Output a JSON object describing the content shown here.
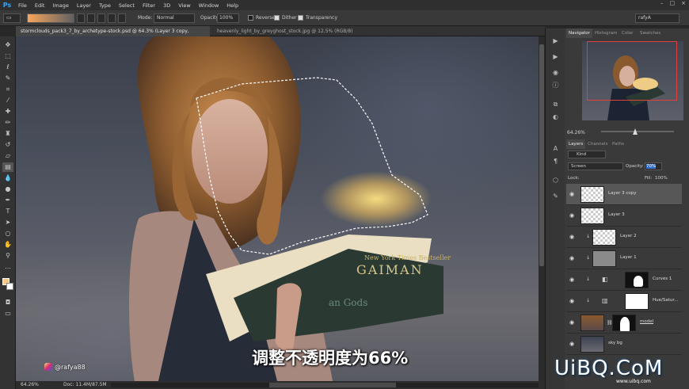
{
  "menubar": {
    "logo": "Ps",
    "items": [
      "File",
      "Edit",
      "Image",
      "Layer",
      "Type",
      "Select",
      "Filter",
      "3D",
      "View",
      "Window",
      "Help"
    ],
    "window_controls": [
      "–",
      "□",
      "×"
    ]
  },
  "options": {
    "mode_label": "Mode:",
    "mode_value": "Normal",
    "opacity_label": "Opacity:",
    "opacity_value": "100%",
    "reverse": "Reverse",
    "dither": "Dither",
    "transparency": "Transparency",
    "workspace": "rafyA",
    "gradient_colors": [
      "#f7a55a",
      "#ffffff"
    ]
  },
  "tabs": [
    {
      "label": "stormclouds_pack3_7_by_archetype-stock.psd @ 64.3% (Layer 3 copy, RGB/8) *",
      "active": true
    },
    {
      "label": "heavenly_light_by_greyghost_stock.jpg @ 12.5% (RGB/8)",
      "active": false
    }
  ],
  "status": {
    "zoom": "64.26%",
    "doc": "Doc: 11.4M/87.5M"
  },
  "watermark": {
    "handle": "@rafya88"
  },
  "caption": "调整不透明度为66%",
  "navigator": {
    "tabs": [
      "Navigator",
      "Histogram",
      "Color",
      "Swatches"
    ],
    "zoom": "64.26%"
  },
  "layers_panel": {
    "tabs": [
      "Layers",
      "Channels",
      "Paths"
    ],
    "filter": "Kind",
    "blend_mode": "Screen",
    "opacity_label": "Opacity:",
    "opacity_value": "70%",
    "lock_label": "Lock:",
    "fill_label": "Fill:",
    "fill_value": "100%",
    "layers": [
      {
        "name": "Layer 3 copy",
        "selected": true
      },
      {
        "name": "Layer 3"
      },
      {
        "name": "Layer 2"
      },
      {
        "name": "Layer 1"
      },
      {
        "name": "Curves 1"
      },
      {
        "name": "Hue/Satur..."
      },
      {
        "name": "model"
      },
      {
        "name": "sky bg"
      }
    ]
  },
  "book": {
    "line1": "New York Times Bestseller",
    "line2": "GAIMAN",
    "line3": "an Gods"
  },
  "site_watermark": {
    "text": "UiBQ.CoM",
    "url": "www.uibq.com"
  },
  "colors": {
    "accent": "#31a8ff",
    "selection_red": "#e0413c",
    "glow": "#ffe08a"
  }
}
